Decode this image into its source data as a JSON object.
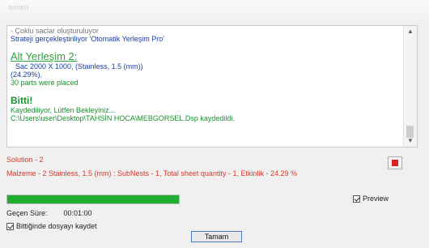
{
  "header": {
    "partial_text": "amam"
  },
  "log": {
    "lines": [
      "- Çoklu saclar oluşturuluyor",
      "Strateji gerçekleştiriliyor 'Otomatik Yerleşim Pro'",
      "Alt Yerleşim 2:",
      "Sac 2000 X 1000, (Stainless, 1.5 (mm))",
      "(24.29%).",
      "30 parts were placed",
      "Bitti!",
      "Kaydediliyor, Lütfen Bekleyiniz...",
      "C:\\Users\\user\\Desktop\\TAHSİN HOCA\\MEBGORSEL.Dsp  kaydedildi."
    ]
  },
  "status": {
    "solution": "Solution - 2",
    "material": "Malzeme - 2  Stainless, 1.5 (mm) : SubNests - 1, Total sheet quantity - 1, Etkinlik - 24.29 %"
  },
  "progress": {
    "value": 1.0
  },
  "preview": {
    "label": "Preview",
    "checked": true
  },
  "elapsed": {
    "label": "Geçen Süre:",
    "value": "00:01:00"
  },
  "save_on_finish": {
    "label": "Bittiğinde dosyayı kaydet",
    "checked": true
  },
  "ok_button": {
    "label": "Tamam"
  },
  "colors": {
    "progress": "#1fae30",
    "stop": "#e02020",
    "status_text": "#d43b2b",
    "log_green": "#1c8e2f",
    "log_blue": "#1a3f9c"
  },
  "icons": {
    "stop": "stop-icon",
    "scroll_up": "chevron-up-icon",
    "scroll_down": "chevron-down-icon"
  }
}
